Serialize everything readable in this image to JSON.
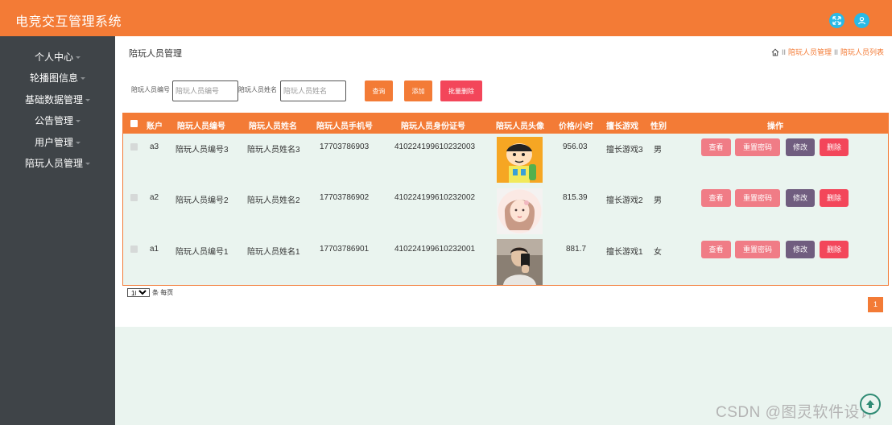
{
  "header": {
    "app_title": "电竞交互管理系统",
    "icons": [
      "fullscreen-icon",
      "user-icon"
    ]
  },
  "sidebar": {
    "items": [
      {
        "label": "个人中心"
      },
      {
        "label": "轮播图信息"
      },
      {
        "label": "基础数据管理"
      },
      {
        "label": "公告管理"
      },
      {
        "label": "用户管理"
      },
      {
        "label": "陪玩人员管理"
      }
    ]
  },
  "page": {
    "title": "陪玩人员管理",
    "breadcrumb": [
      "陪玩人员管理",
      "陪玩人员列表"
    ],
    "breadcrumb_sep": "II"
  },
  "search": {
    "number_label": "陪玩人员编号",
    "number_placeholder": "陪玩人员编号",
    "name_label": "陪玩人员姓名",
    "name_placeholder": "陪玩人员姓名",
    "query_button": "查询",
    "add_button": "添加",
    "batch_delete_button": "批量删除"
  },
  "table": {
    "columns": [
      "账户",
      "陪玩人员编号",
      "陪玩人员姓名",
      "陪玩人员手机号",
      "陪玩人员身份证号",
      "陪玩人员头像",
      "价格/小时",
      "擅长游戏",
      "性别",
      "操作"
    ],
    "rows": [
      {
        "account": "a3",
        "number": "陪玩人员编号3",
        "name": "陪玩人员姓名3",
        "phone": "17703786903",
        "id_card": "410224199610232003",
        "avatar": "cartoon-avatar",
        "price": "956.03",
        "game": "擅长游戏3",
        "gender": "男"
      },
      {
        "account": "a2",
        "number": "陪玩人员编号2",
        "name": "陪玩人员姓名2",
        "phone": "17703786902",
        "id_card": "410224199610232002",
        "avatar": "illustrated-girl-avatar",
        "price": "815.39",
        "game": "擅长游戏2",
        "gender": "男"
      },
      {
        "account": "a1",
        "number": "陪玩人员编号1",
        "name": "陪玩人员姓名1",
        "phone": "17703786901",
        "id_card": "410224199610232001",
        "avatar": "mirror-selfie-avatar",
        "price": "881.7",
        "game": "擅长游戏1",
        "gender": "女"
      }
    ],
    "actions": {
      "view": "查看",
      "reset_password": "重置密码",
      "edit": "修改",
      "delete": "删除"
    }
  },
  "pagination": {
    "page_size": "10",
    "per_page_label": "条 每页",
    "current_page": "1"
  },
  "watermark": "CSDN @图灵软件设计",
  "colors": {
    "accent": "#f37b36",
    "sidebar": "#3f4448",
    "danger": "#f3465a",
    "soft_red": "#f07c86",
    "purple": "#705d7f",
    "icon_blue": "#29b9e6",
    "table_bg": "#eaf4ef"
  }
}
